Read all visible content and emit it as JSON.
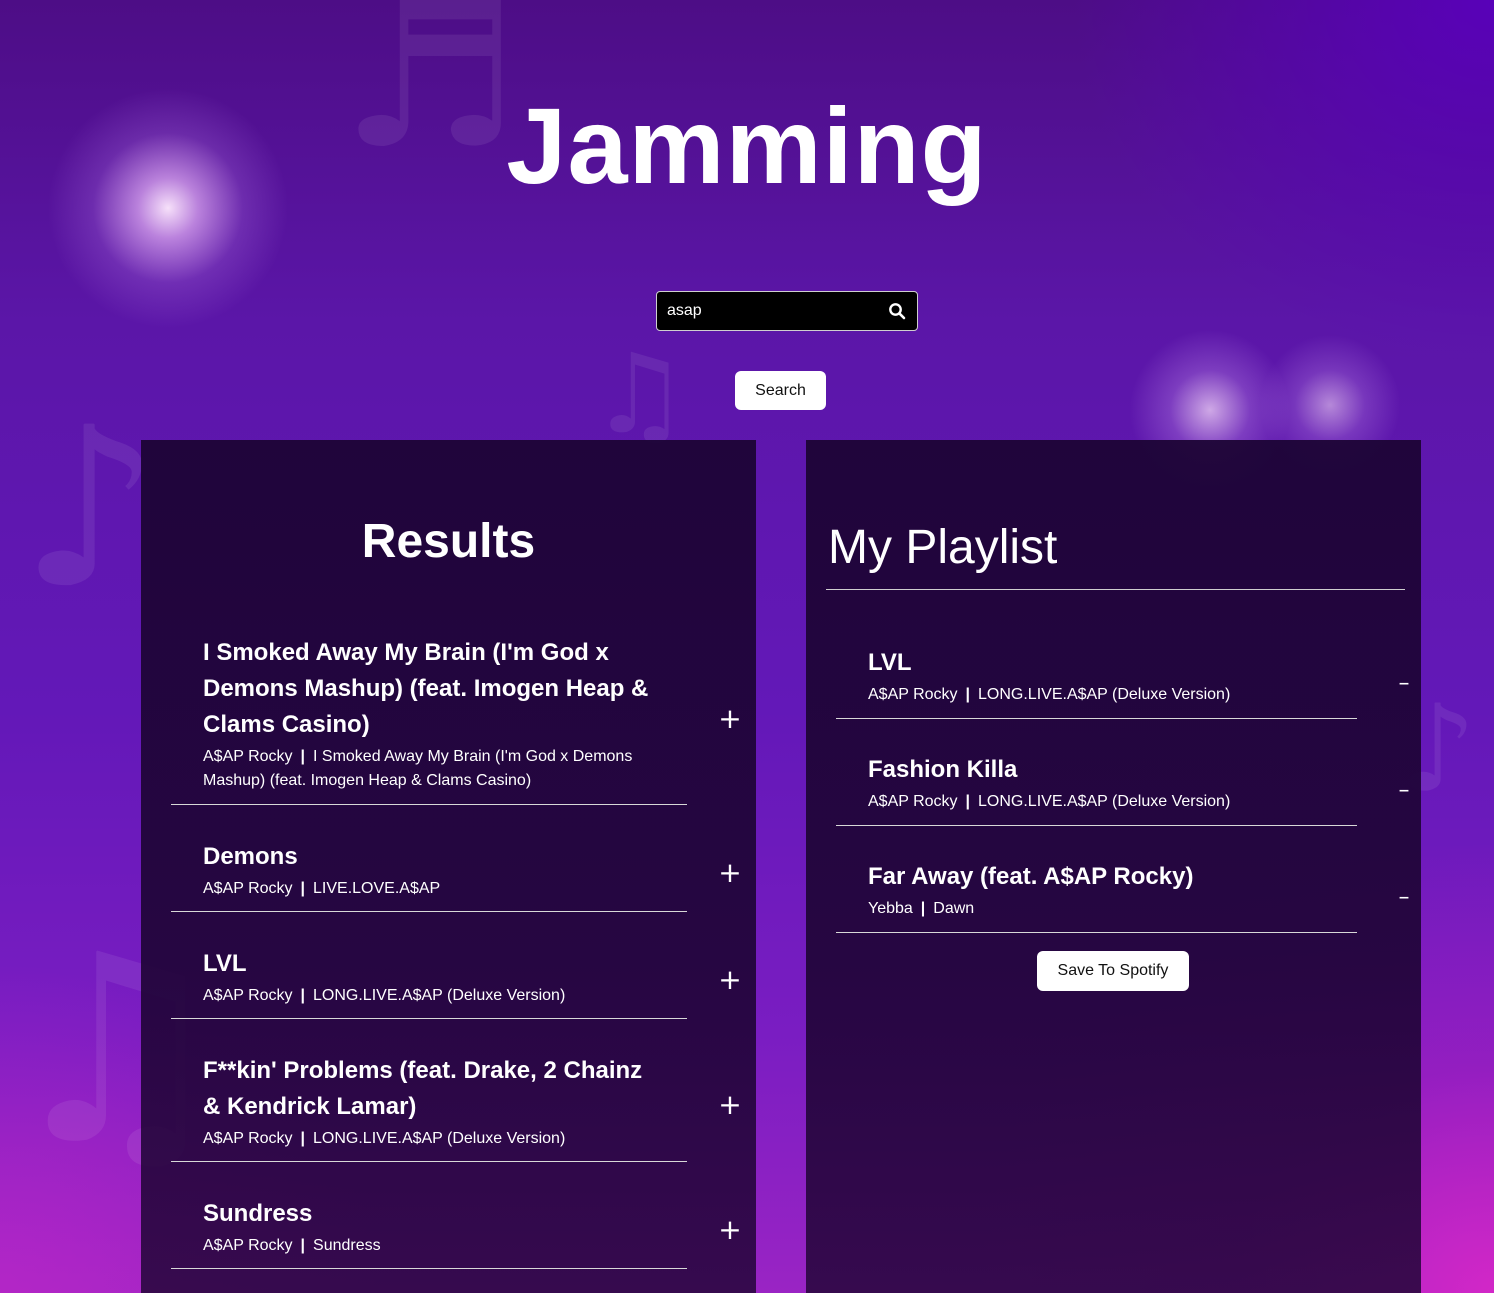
{
  "app": {
    "title": "Jamming"
  },
  "search": {
    "value": "asap",
    "button_label": "Search"
  },
  "results": {
    "title": "Results",
    "add_symbol": "+",
    "separator": "|",
    "tracks": [
      {
        "name": "I Smoked Away My Brain (I'm God x Demons Mashup) (feat. Imogen Heap & Clams Casino)",
        "artist": "A$AP Rocky",
        "album": "I Smoked Away My Brain (I'm God x Demons Mashup) (feat. Imogen Heap & Clams Casino)"
      },
      {
        "name": "Demons",
        "artist": "A$AP Rocky",
        "album": "LIVE.LOVE.A$AP"
      },
      {
        "name": "LVL",
        "artist": "A$AP Rocky",
        "album": "LONG.LIVE.A$AP (Deluxe Version)"
      },
      {
        "name": "F**kin' Problems (feat. Drake, 2 Chainz & Kendrick Lamar)",
        "artist": "A$AP Rocky",
        "album": "LONG.LIVE.A$AP (Deluxe Version)"
      },
      {
        "name": "Sundress",
        "artist": "A$AP Rocky",
        "album": "Sundress"
      }
    ]
  },
  "playlist": {
    "title": "My Playlist",
    "remove_symbol": "–",
    "separator": "|",
    "save_label": "Save To Spotify",
    "tracks": [
      {
        "name": "LVL",
        "artist": "A$AP Rocky",
        "album": "LONG.LIVE.A$AP (Deluxe Version)"
      },
      {
        "name": "Fashion Killa",
        "artist": "A$AP Rocky",
        "album": "LONG.LIVE.A$AP (Deluxe Version)"
      },
      {
        "name": "Far Away (feat. A$AP Rocky)",
        "artist": "Yebba",
        "album": "Dawn"
      }
    ]
  }
}
